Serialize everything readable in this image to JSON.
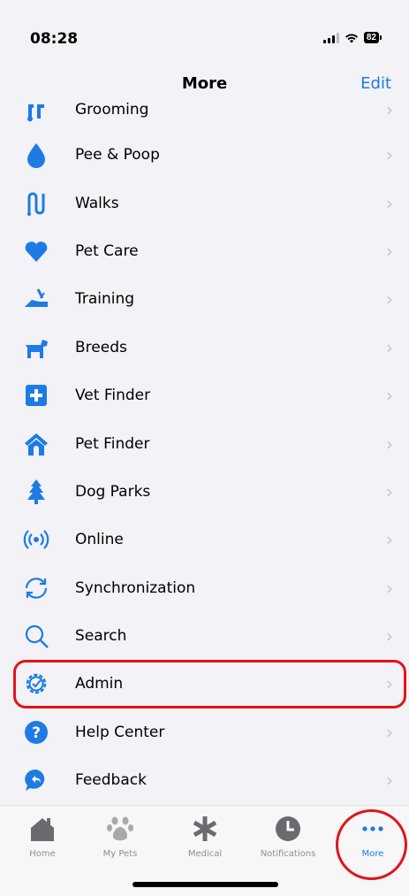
{
  "status_bar": {
    "time": "08:28",
    "battery": "82"
  },
  "nav": {
    "title": "More",
    "edit_label": "Edit"
  },
  "menu": [
    {
      "label": "Grooming",
      "icon": "grooming-icon"
    },
    {
      "label": "Pee & Poop",
      "icon": "drop-icon"
    },
    {
      "label": "Walks",
      "icon": "walks-icon"
    },
    {
      "label": "Pet Care",
      "icon": "heart-icon"
    },
    {
      "label": "Training",
      "icon": "training-icon"
    },
    {
      "label": "Breeds",
      "icon": "dog-icon"
    },
    {
      "label": "Vet Finder",
      "icon": "medical-cross-icon"
    },
    {
      "label": "Pet Finder",
      "icon": "house-icon"
    },
    {
      "label": "Dog Parks",
      "icon": "tree-icon"
    },
    {
      "label": "Online",
      "icon": "broadcast-icon"
    },
    {
      "label": "Synchronization",
      "icon": "sync-icon"
    },
    {
      "label": "Search",
      "icon": "search-icon"
    },
    {
      "label": "Admin",
      "icon": "gear-icon"
    },
    {
      "label": "Help Center",
      "icon": "help-icon"
    },
    {
      "label": "Feedback",
      "icon": "feedback-icon"
    }
  ],
  "tabs": [
    {
      "label": "Home",
      "icon": "home-icon"
    },
    {
      "label": "My Pets",
      "icon": "paw-icon"
    },
    {
      "label": "Medical",
      "icon": "asterisk-icon"
    },
    {
      "label": "Notifications",
      "icon": "clock-icon"
    },
    {
      "label": "More",
      "icon": "ellipsis-icon",
      "active": true
    }
  ],
  "colors": {
    "accent": "#1d7be3",
    "highlight": "#e0141c",
    "inactive": "#8e8e93"
  }
}
